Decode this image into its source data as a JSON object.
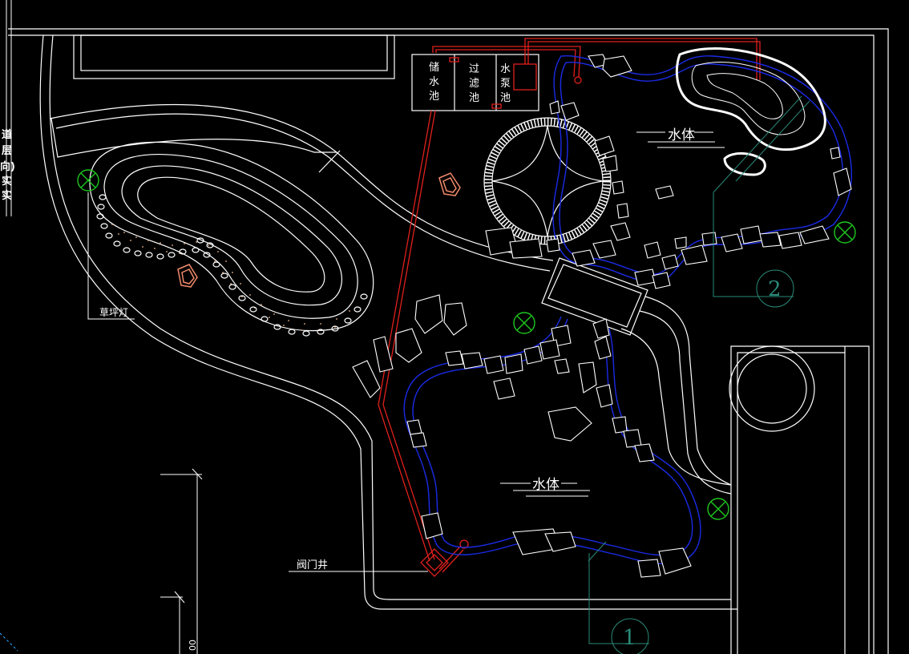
{
  "tanks": {
    "storage": [
      "储",
      "水",
      "池"
    ],
    "filter": [
      "过",
      "滤",
      "池"
    ],
    "pump": [
      "水",
      "泵",
      "池"
    ]
  },
  "labels": {
    "water_north": "水体",
    "water_south": "水体",
    "lawn_light": "草坪灯",
    "valve_well": "阀门井"
  },
  "tags": {
    "section_1": "1",
    "section_2": "2"
  },
  "side_fragments": [
    "道",
    "层",
    "向)",
    "实",
    "实"
  ],
  "dimension_fragment": "00",
  "colors": {
    "background": "#000000",
    "linework": "#ffffff",
    "pipe": "#e0201c",
    "water_edge": "#1a2be6",
    "lamp": "#1ec81e",
    "section_tag": "#2a8a78",
    "stepping_stone": "#f28a6a"
  }
}
